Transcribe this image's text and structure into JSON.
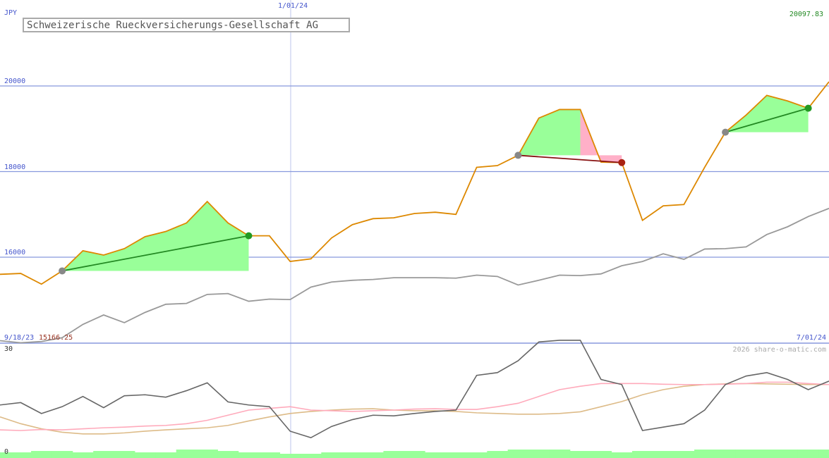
{
  "title": "Schweizerische Rueckversicherungs-Gesellschaft AG",
  "currency": "JPY",
  "start_date": "9/18/23",
  "end_date": "7/01/24",
  "marker_date": "1/01/24",
  "min_value": "15166.25",
  "max_value": "20097.83",
  "lower_axis_max": "30",
  "lower_axis_min": "0",
  "copyright": "2026 share-o-matic.com",
  "colors": {
    "price": "#dd8800",
    "average": "#999999",
    "grid": "#8899dd",
    "gain_fill": "#99ff99",
    "loss_fill": "#ffb0c8",
    "gain_line": "#228822",
    "loss_line": "#881111",
    "volatility": "#666666",
    "pink_line": "#ffaabb",
    "tan_line": "#ddbb88",
    "volume_bar": "#99ff99"
  },
  "chart_data": {
    "type": "line",
    "y_ticks": [
      16000,
      18000,
      20000
    ],
    "ylim": [
      14000,
      20100
    ],
    "series": [
      {
        "values": [
          15600,
          15620,
          15370,
          15680,
          16150,
          16050,
          16200,
          16480,
          16600,
          16800,
          17300,
          16800,
          16500,
          16500,
          15900,
          15960,
          16450,
          16760,
          16900,
          16920,
          17020,
          17050,
          17000,
          18100,
          18140,
          18380,
          19250,
          19450,
          19450,
          18220,
          18210,
          16860,
          17200,
          17230,
          18100,
          18920,
          19320,
          19780,
          19650,
          19480,
          20097.83
        ]
      },
      {
        "values": [
          14050,
          14000,
          14030,
          14120,
          14430,
          14650,
          14470,
          14710,
          14900,
          14920,
          15130,
          15150,
          14970,
          15020,
          15010,
          15300,
          15420,
          15460,
          15480,
          15520,
          15520,
          15520,
          15510,
          15580,
          15550,
          15350,
          15460,
          15580,
          15570,
          15610,
          15800,
          15900,
          16080,
          15950,
          16190,
          16200,
          16240,
          16530,
          16710,
          16950,
          17140
        ]
      }
    ],
    "trades": [
      {
        "start": 3,
        "end": 12,
        "result": "gain"
      },
      {
        "start": 25,
        "end": 30,
        "result": "loss"
      },
      {
        "start": 35,
        "end": 39,
        "result": "gain"
      }
    ],
    "lower": {
      "ylim": [
        0,
        30
      ],
      "volatility": [
        13.5,
        14.2,
        11.0,
        13.0,
        16.0,
        12.7,
        16.2,
        16.5,
        15.8,
        17.7,
        20.0,
        14.4,
        13.5,
        13.0,
        5.8,
        3.9,
        7.2,
        9.2,
        10.5,
        10.3,
        11.0,
        11.6,
        12.0,
        22.2,
        23.0,
        26.5,
        32.0,
        32.5,
        32.5,
        21.0,
        19.5,
        6.0,
        7.0,
        8.0,
        12.0,
        19.5,
        22.0,
        23.0,
        21.0,
        18.0,
        20.5
      ],
      "pink": [
        6.2,
        6.0,
        6.3,
        6.2,
        6.5,
        6.8,
        7.0,
        7.3,
        7.5,
        8.0,
        9.0,
        10.5,
        12.0,
        12.5,
        13.0,
        12.0,
        11.8,
        11.6,
        11.8,
        12.0,
        12.3,
        12.4,
        12.2,
        12.2,
        13.0,
        14.0,
        16.0,
        18.0,
        19.0,
        19.8,
        19.8,
        19.8,
        19.6,
        19.5,
        19.5,
        19.6,
        19.8,
        20.2,
        20.2,
        19.8,
        19.5
      ],
      "tan": [
        10.0,
        8.0,
        6.5,
        5.5,
        5.0,
        5.0,
        5.3,
        5.8,
        6.2,
        6.5,
        6.8,
        7.5,
        8.8,
        10.0,
        11.0,
        11.6,
        12.0,
        12.3,
        12.4,
        12.0,
        11.8,
        11.8,
        11.6,
        11.2,
        11.0,
        10.8,
        10.8,
        11.0,
        11.5,
        13.0,
        14.5,
        16.5,
        18.0,
        19.0,
        19.5,
        19.7,
        19.8,
        19.7,
        19.6,
        19.5,
        19.5
      ],
      "volume": [
        2,
        2,
        2.5,
        2.5,
        2,
        2.5,
        2.5,
        2,
        2,
        3,
        3,
        2.5,
        2,
        2,
        1.5,
        1.5,
        2,
        2,
        2,
        2.5,
        2.5,
        2,
        2,
        2,
        2.5,
        3,
        3,
        3,
        2.5,
        2.5,
        2,
        2.5,
        2.5,
        2.5,
        3,
        3,
        3,
        3,
        3,
        3,
        3
      ]
    }
  }
}
